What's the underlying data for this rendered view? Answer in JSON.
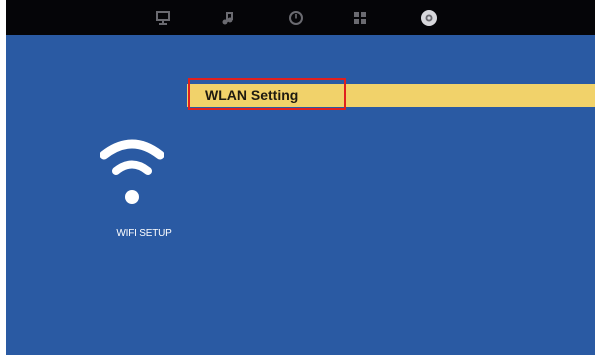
{
  "colors": {
    "background": "#2a5aa3",
    "top_bar": "#050508",
    "highlight_row": "#f1d26a",
    "selection_border": "#e0201e",
    "tab_icon": "#6a6a70",
    "tab_icon_active": "#d8d8dc"
  },
  "top_bar": {
    "tabs": [
      {
        "icon": "monitor-icon",
        "active": false
      },
      {
        "icon": "music-icon",
        "active": false
      },
      {
        "icon": "clock-icon",
        "active": false
      },
      {
        "icon": "grid-icon",
        "active": false
      },
      {
        "icon": "settings-icon",
        "active": true
      }
    ]
  },
  "section": {
    "icon": "wifi-icon",
    "label": "WIFI SETUP"
  },
  "menu": {
    "items": [
      {
        "label": "WLAN Setting",
        "selected": true
      }
    ]
  }
}
